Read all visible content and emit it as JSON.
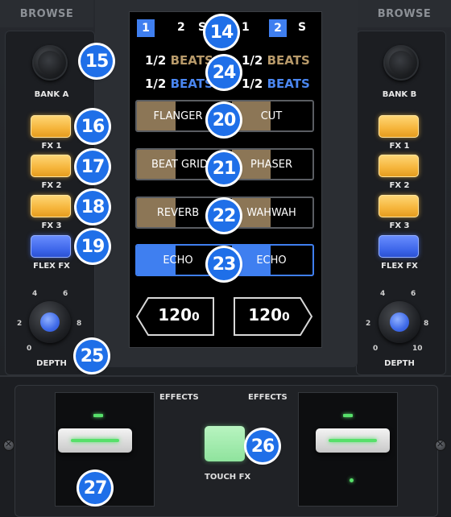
{
  "browse_left": "BROWSE",
  "browse_right": "BROWSE",
  "left": {
    "bank_label": "BANK A",
    "fx1": "FX 1",
    "fx2": "FX 2",
    "fx3": "FX 3",
    "flex": "FLEX FX",
    "depth": "DEPTH",
    "ticks": [
      "0",
      "2",
      "4",
      "6",
      "8"
    ]
  },
  "right": {
    "bank_label": "BANK B",
    "fx1": "FX 1",
    "fx2": "FX 2",
    "fx3": "FX 3",
    "flex": "FLEX FX",
    "depth": "DEPTH",
    "ticks": [
      "0",
      "2",
      "4",
      "6",
      "8",
      "10"
    ]
  },
  "screen": {
    "deck_tabs": [
      "1",
      "2",
      "S",
      "1",
      "2",
      "S"
    ],
    "beats_row1": {
      "frac_left": "1/2",
      "label_left": "BEATS",
      "frac_right": "1/2",
      "label_right": "BEATS"
    },
    "beats_row2": {
      "frac_left": "1/2",
      "label_left": "BEATS",
      "frac_right": "1/2",
      "label_right": "BEATS"
    },
    "slots": [
      {
        "left": "FLANGER",
        "right": "CUT"
      },
      {
        "left": "BEAT GRID",
        "right": "PHASER"
      },
      {
        "left": "REVERB",
        "right": "WAHWAH"
      },
      {
        "left": "ECHO",
        "right": "ECHO"
      }
    ],
    "bpm_left_main": "120",
    "bpm_left_sub": "0",
    "bpm_right_main": "120",
    "bpm_right_sub": "0"
  },
  "bottom": {
    "effects_left": "EFFECTS",
    "effects_right": "EFFECTS",
    "touch_fx": "TOUCH FX"
  },
  "callouts": [
    "14",
    "15",
    "16",
    "17",
    "18",
    "19",
    "20",
    "21",
    "22",
    "23",
    "24",
    "25",
    "26",
    "27"
  ],
  "colors": {
    "accent_blue": "#3f7ff0",
    "fx_amber": "#f5b43a",
    "beats_gold": "#b89a6a",
    "led_green": "#57e06a"
  }
}
